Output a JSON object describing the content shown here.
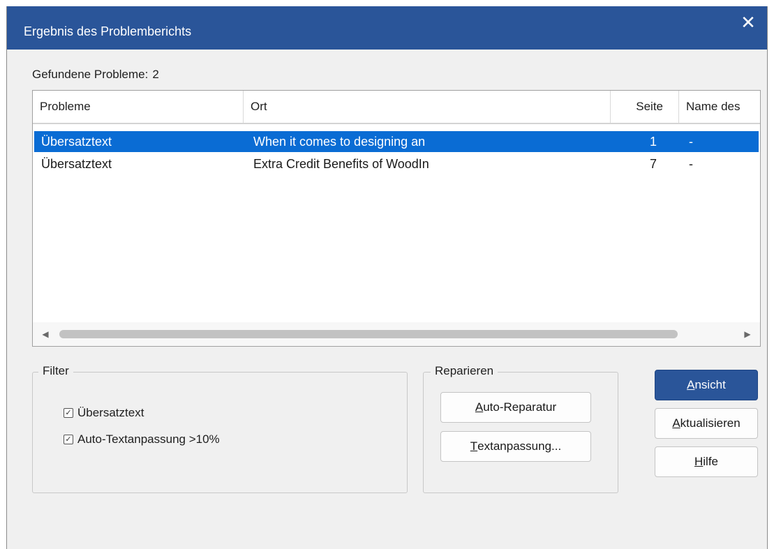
{
  "dialog": {
    "title": "Ergebnis des Problemberichts",
    "close_glyph": "✕",
    "close_icon": "close-icon"
  },
  "summary": {
    "label": "Gefundene Probleme:",
    "count": "2"
  },
  "table": {
    "columns": [
      "Probleme",
      "Ort",
      "Seite",
      "Name des"
    ],
    "rows": [
      {
        "problem": "Übersatztext",
        "ort": "When it comes to designing an",
        "seite": "1",
        "name": "-",
        "selected": true
      },
      {
        "problem": "Übersatztext",
        "ort": "Extra Credit Benefits of WoodIn",
        "seite": "7",
        "name": "-",
        "selected": false
      }
    ]
  },
  "filter": {
    "title": "Filter",
    "options": [
      {
        "label": "Übersatztext",
        "checked": true
      },
      {
        "label": "Auto-Textanpassung >10%",
        "checked": true
      }
    ]
  },
  "repair": {
    "title": "Reparieren",
    "auto_repair": {
      "mnemonic": "A",
      "rest": "uto-Reparatur"
    },
    "text_fit": {
      "mnemonic": "T",
      "rest": "extanpassung..."
    }
  },
  "buttons": {
    "view": {
      "mnemonic": "A",
      "rest": "nsicht"
    },
    "refresh": {
      "mnemonic": "A",
      "rest": "ktualisieren"
    },
    "help": {
      "mnemonic": "H",
      "rest": "ilfe"
    }
  },
  "colors": {
    "titlebar": "#2a5599",
    "selection": "#0a6cd4",
    "primary_button": "#2a5599"
  }
}
